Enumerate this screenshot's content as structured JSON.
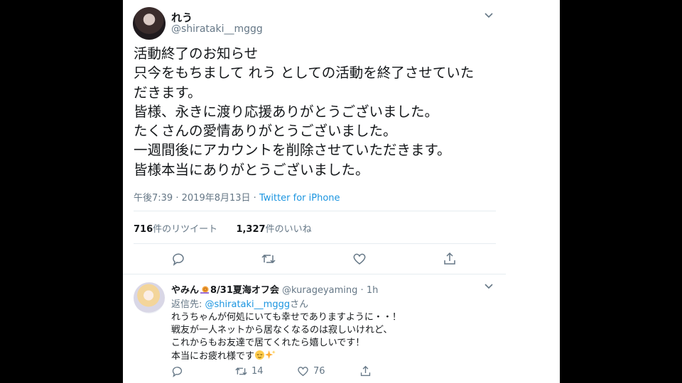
{
  "tweet": {
    "display_name": "れう",
    "handle": "@shirataki__mggg",
    "lines": [
      "活動終了のお知らせ",
      "只今をもちまして れう としての活動を終了させていた",
      "だきます。",
      "皆様、永きに渡り応援ありがとうございました。",
      "たくさんの愛情ありがとうございました。",
      "一週間後にアカウントを削除させていただきます。",
      "皆様本当にありがとうございました。"
    ],
    "time": "午後7:39",
    "date": "2019年8月13日",
    "separator": "·",
    "source": "Twitter for iPhone",
    "retweet_count": "716",
    "retweet_label": "件のリツイート",
    "like_count": "1,327",
    "like_label": "件のいいね"
  },
  "reply": {
    "display_name_prefix": "やみん",
    "display_name_suffix": "8/31夏海オフ会",
    "handle": "@kurageyaming",
    "time": "1h",
    "replying_label": "返信先: ",
    "replying_handle": "@shirataki__mggg",
    "replying_suffix": "さん",
    "lines": [
      "れうちゃんが何処にいても幸せでありますように・・！",
      "戦友が一人ネットから居なくなるのは寂しいけれど、",
      "これからもお友達で居てくれたら嬉しいです！",
      "本当にお疲れ様です"
    ],
    "retweets": "14",
    "likes": "76"
  },
  "icons": [
    "chevron-down-icon",
    "reply-icon",
    "retweet-icon",
    "like-icon",
    "share-icon",
    "snail-icon",
    "relieved-face-icon",
    "sparkles-icon"
  ],
  "colors": {
    "link": "#1b95e0",
    "text": "#14171a",
    "muted": "#657786",
    "divider": "#e6ecf0"
  }
}
